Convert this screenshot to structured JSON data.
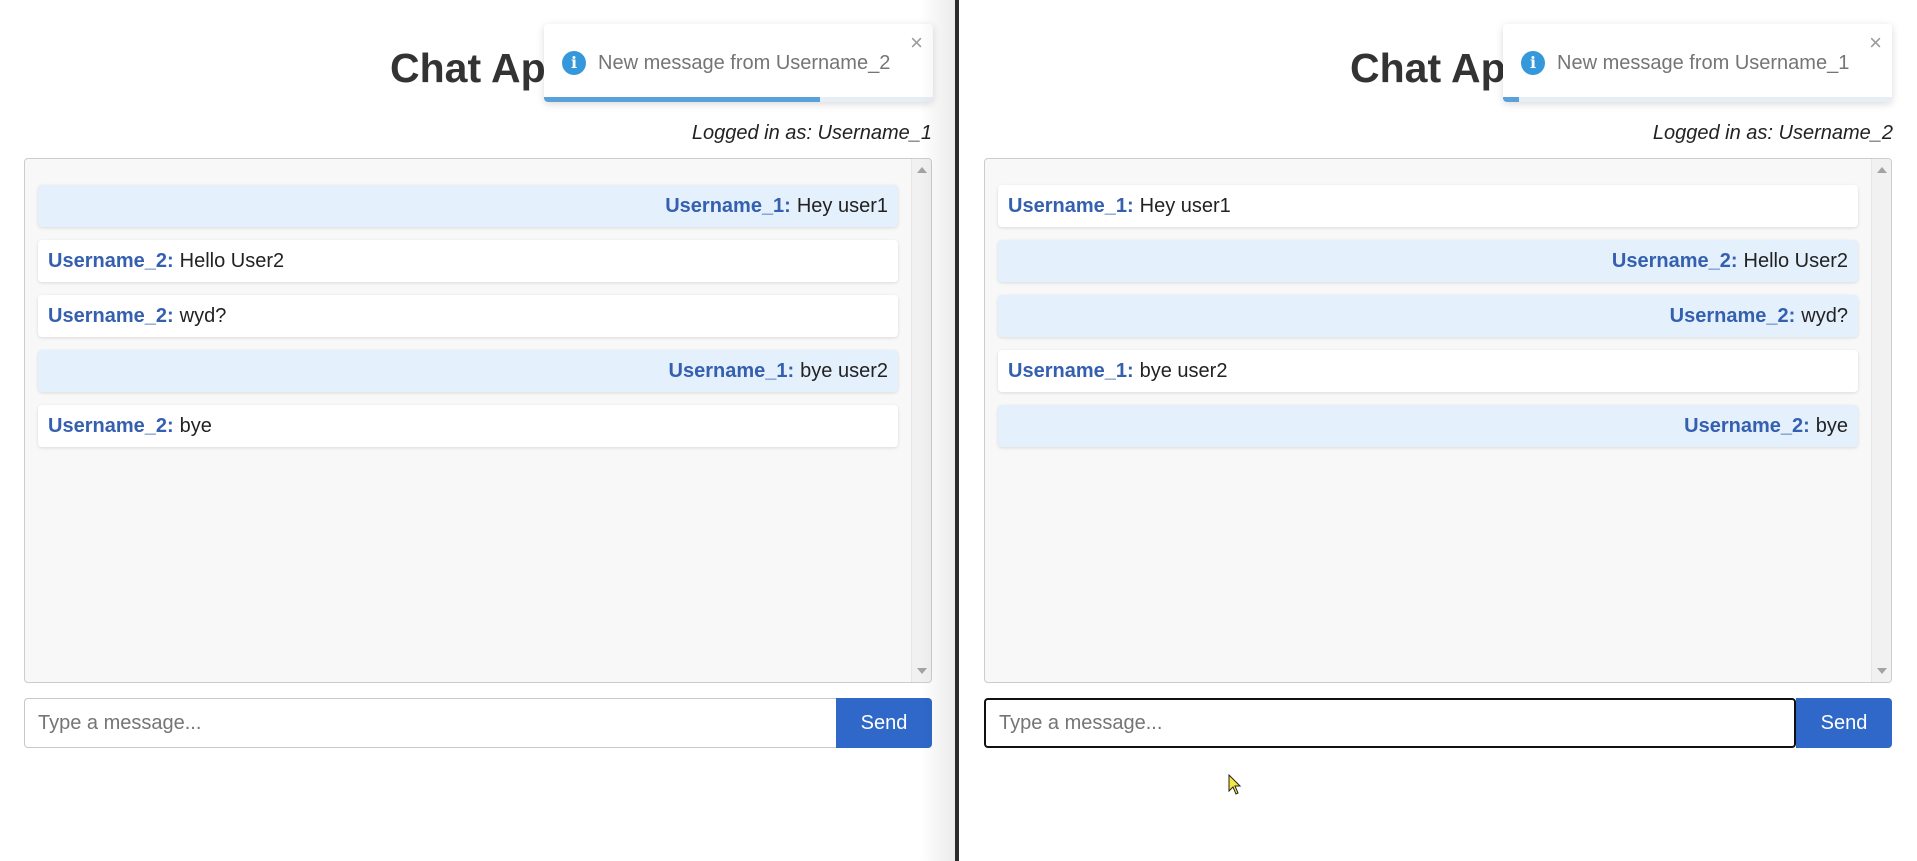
{
  "panes": [
    {
      "id": "left",
      "title": "Chat App",
      "logged_in": "Logged in as: Username_1",
      "me": "Username_1",
      "messages": [
        {
          "user": "Username_1:",
          "text": "Hey user1"
        },
        {
          "user": "Username_2:",
          "text": "Hello User2"
        },
        {
          "user": "Username_2:",
          "text": "wyd?"
        },
        {
          "user": "Username_1:",
          "text": "bye user2"
        },
        {
          "user": "Username_2:",
          "text": "bye"
        }
      ],
      "input": {
        "placeholder": "Type a message...",
        "value": ""
      },
      "send_label": "Send",
      "toast": {
        "text": "New message from Username_2",
        "close": "×",
        "icon": "info-icon",
        "progress": 0.71
      }
    },
    {
      "id": "right",
      "title": "Chat App",
      "logged_in": "Logged in as: Username_2",
      "me": "Username_2",
      "messages": [
        {
          "user": "Username_1:",
          "text": "Hey user1"
        },
        {
          "user": "Username_2:",
          "text": "Hello User2"
        },
        {
          "user": "Username_2:",
          "text": "wyd?"
        },
        {
          "user": "Username_1:",
          "text": "bye user2"
        },
        {
          "user": "Username_2:",
          "text": "bye"
        }
      ],
      "input": {
        "placeholder": "Type a message...",
        "value": ""
      },
      "send_label": "Send",
      "toast": {
        "text": "New message from Username_1",
        "close": "×",
        "icon": "info-icon",
        "progress": 0.04
      }
    }
  ],
  "colors": {
    "accent": "#2f68c9",
    "username": "#3560b0",
    "own_message_bg": "#e4f0fc",
    "toast_progress": "#5aa0da"
  }
}
